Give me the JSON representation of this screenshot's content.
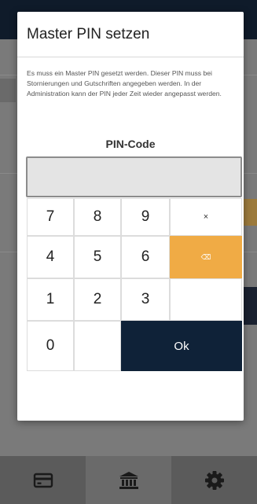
{
  "dialog": {
    "title": "Master PIN setzen",
    "message": "Es muss ein Master PIN gesetzt werden. Dieser PIN muss bei Stornierungen und Gutschriften angegeben werden. In der Administration kann der PIN jeder Zeit wieder angepasst werden.",
    "pin_label": "PIN-Code",
    "pin_value": ""
  },
  "keypad": {
    "k1": "1",
    "k2": "2",
    "k3": "3",
    "k4": "4",
    "k5": "5",
    "k6": "6",
    "k7": "7",
    "k8": "8",
    "k9": "9",
    "k0": "0",
    "clear": "×",
    "backspace": "⌫",
    "ok": "Ok"
  },
  "bottom_nav": {
    "items": [
      {
        "icon": "card-icon"
      },
      {
        "icon": "bank-icon"
      },
      {
        "icon": "gear-icon"
      }
    ]
  },
  "colors": {
    "accent_orange": "#f0ab45",
    "dark_navy": "#0f2238"
  }
}
